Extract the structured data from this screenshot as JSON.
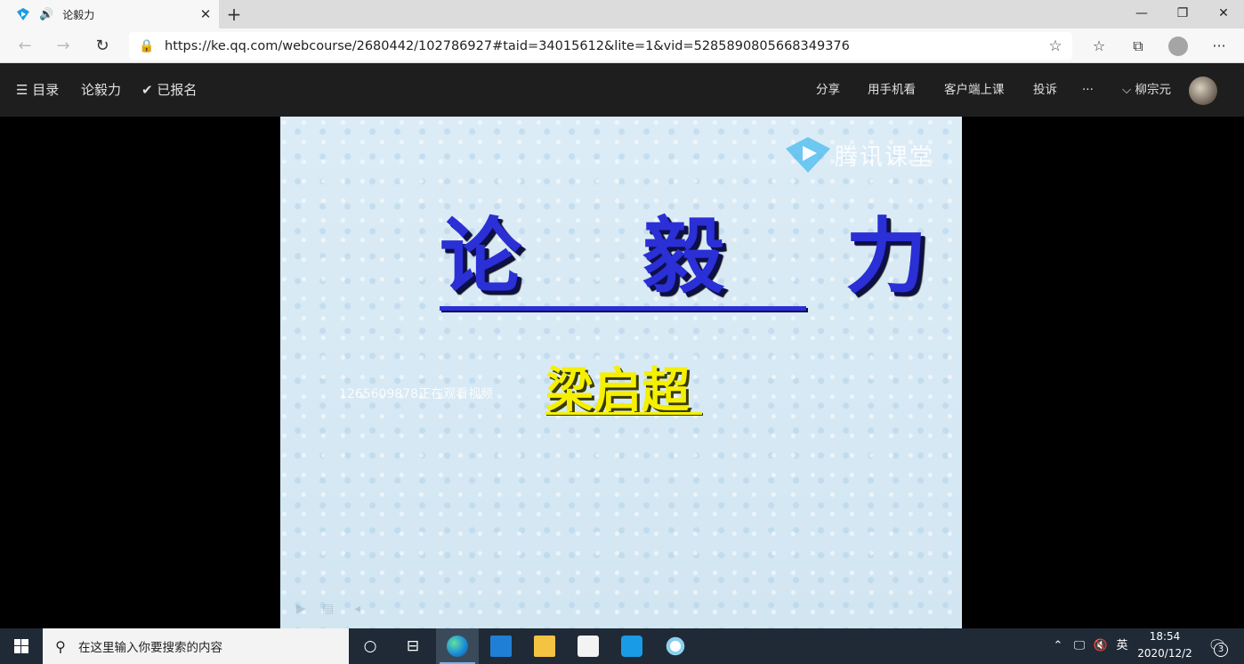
{
  "browser": {
    "tab": {
      "title": "论毅力",
      "favicon": "tencent-classroom-icon",
      "audio": "speaker-icon"
    },
    "window_controls": [
      "minimize-icon",
      "restore-icon",
      "close-icon"
    ],
    "url": "https://ke.qq.com/webcourse/2680442/102786927#taid=34015612&lite=1&vid=5285890805668349376"
  },
  "site_header": {
    "menu_label": "目录",
    "course_title": "论毅力",
    "enrolled_label": "已报名",
    "actions": [
      "分享",
      "用手机看",
      "客户端上课",
      "投诉",
      "···"
    ],
    "username": "柳宗元"
  },
  "video": {
    "brand": "腾讯课堂",
    "title": "论 毅 力",
    "author": "梁启超",
    "viewer_watermark": "1265609878正在观看视频"
  },
  "taskbar": {
    "search_placeholder": "在这里输入你要搜索的内容",
    "ime": "英",
    "time": "18:54",
    "date": "2020/12/2",
    "notification_count": "3"
  },
  "colors": {
    "header_bg": "#1e1e1e",
    "title_blue": "#2a2fd6",
    "author_yellow": "#f5f000",
    "taskbar_bg": "#1f2a36"
  }
}
